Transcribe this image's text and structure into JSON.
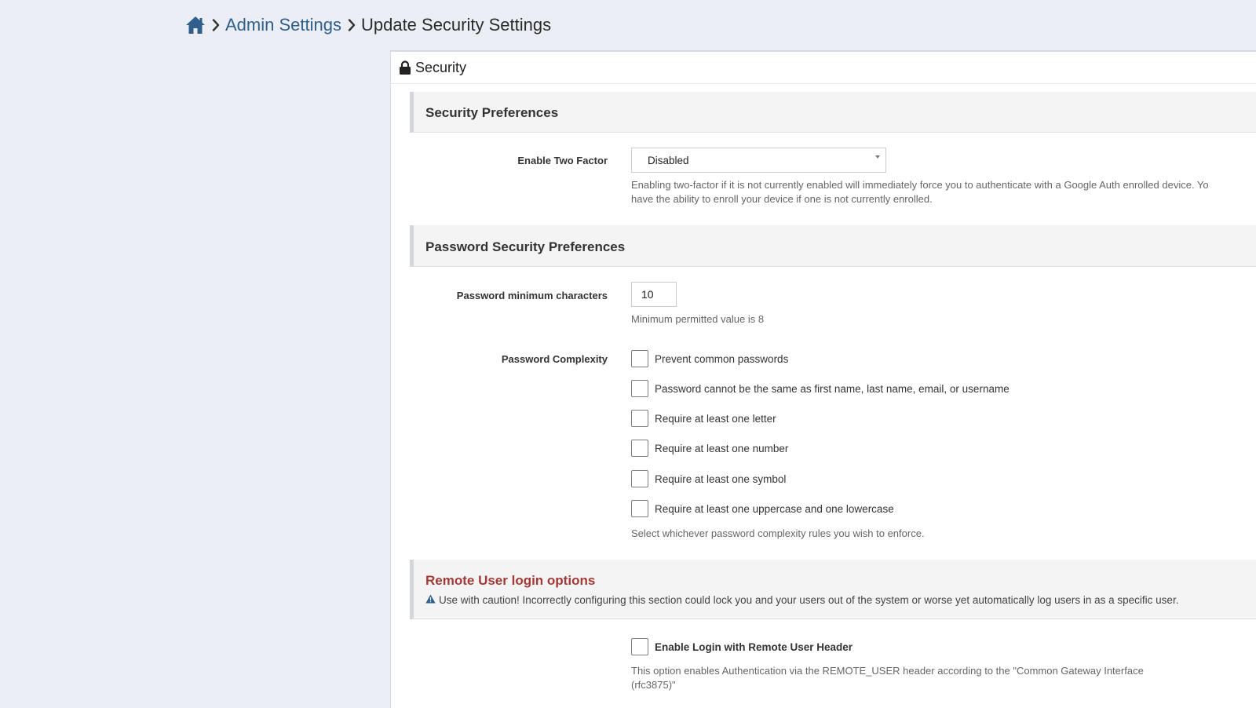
{
  "breadcrumb": {
    "home_icon": "home-icon",
    "separator_icon": "chevron-right-icon",
    "admin_settings": "Admin Settings",
    "current": "Update Security Settings"
  },
  "panel": {
    "icon": "lock-icon",
    "title": "Security"
  },
  "sections": {
    "security_preferences": {
      "title": "Security Preferences",
      "two_factor": {
        "label": "Enable Two Factor",
        "value": "Disabled",
        "help_line1": "Enabling two-factor if it is not currently enabled will immediately force you to authenticate with a Google Auth enrolled device. Yo",
        "help_line2": "have the ability to enroll your device if one is not currently enrolled."
      }
    },
    "password_preferences": {
      "title": "Password Security Preferences",
      "min_chars": {
        "label": "Password minimum characters",
        "value": "10",
        "help": "Minimum permitted value is 8"
      },
      "complexity": {
        "label": "Password Complexity",
        "options": [
          "Prevent common passwords",
          "Password cannot be the same as first name, last name, email, or username",
          "Require at least one letter",
          "Require at least one number",
          "Require at least one symbol",
          "Require at least one uppercase and one lowercase"
        ],
        "help": "Select whichever password complexity rules you wish to enforce."
      }
    },
    "remote_user": {
      "title": "Remote User login options",
      "warning_icon": "warning-icon",
      "warning": "Use with caution! Incorrectly configuring this section could lock you and your users out of the system or worse yet automatically log users in as a specific user.",
      "enable_label": "Enable Login with Remote User Header",
      "help_line1": "This option enables Authentication via the REMOTE_USER header according to the \"Common Gateway Interface",
      "help_line2": "(rfc3875)\""
    }
  },
  "colors": {
    "background": "#ebeff5",
    "link": "#2f5f8a",
    "warning_title": "#a33a35",
    "section_bg": "#f4f4f4"
  }
}
